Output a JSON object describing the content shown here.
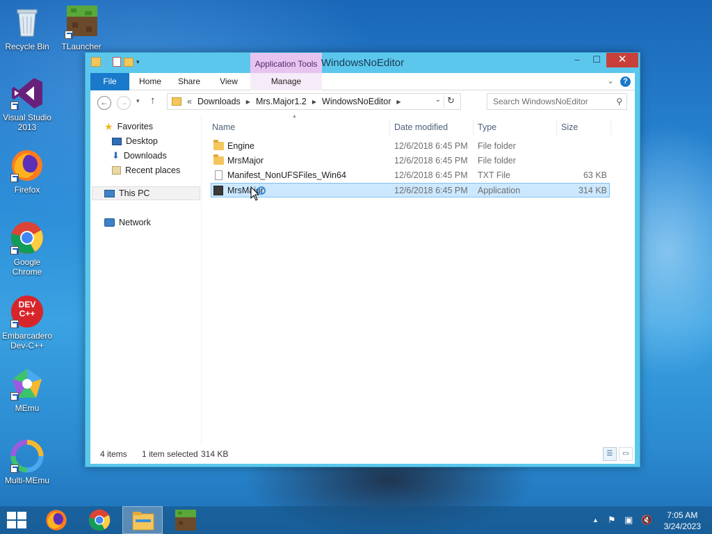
{
  "desktop": {
    "icons": [
      {
        "label": "Recycle Bin"
      },
      {
        "label": "TLauncher"
      },
      {
        "label": "Visual Studio 2013"
      },
      {
        "label": "Firefox"
      },
      {
        "label": "Google Chrome"
      },
      {
        "label": "Embarcadero Dev-C++"
      },
      {
        "label": "MEmu"
      },
      {
        "label": "Multi-MEmu"
      }
    ],
    "dev_logo_text": "DEV C++"
  },
  "window": {
    "title": "WindowsNoEditor",
    "context_tab": "Application Tools",
    "buttons": {
      "minimize": "–",
      "maximize": "☐",
      "close": "✕"
    }
  },
  "ribbon": {
    "tabs": [
      "File",
      "Home",
      "Share",
      "View",
      "Manage"
    ],
    "help": "?"
  },
  "address_bar": {
    "prefix": "«",
    "crumbs": [
      "Downloads",
      "Mrs.Major1.2",
      "WindowsNoEditor"
    ]
  },
  "search": {
    "placeholder": "Search WindowsNoEditor"
  },
  "nav_pane": {
    "favorites": "Favorites",
    "items": [
      "Desktop",
      "Downloads",
      "Recent places"
    ],
    "this_pc": "This PC",
    "network": "Network"
  },
  "file_list": {
    "columns": [
      "Name",
      "Date modified",
      "Type",
      "Size"
    ],
    "rows": [
      {
        "name": "Engine",
        "date": "12/6/2018 6:45 PM",
        "type": "File folder",
        "size": "",
        "icon": "folder-icon"
      },
      {
        "name": "MrsMajor",
        "date": "12/6/2018 6:45 PM",
        "type": "File folder",
        "size": "",
        "icon": "folder-icon"
      },
      {
        "name": "Manifest_NonUFSFiles_Win64",
        "date": "12/6/2018 6:45 PM",
        "type": "TXT File",
        "size": "63 KB",
        "icon": "text-file-icon"
      },
      {
        "name": "MrsMajor",
        "date": "12/6/2018 6:45 PM",
        "type": "Application",
        "size": "314 KB",
        "icon": "application-icon",
        "selected": true
      }
    ]
  },
  "status": {
    "items": "4 items",
    "selected": "1 item selected",
    "size": "314 KB"
  },
  "taskbar": {
    "clock_time": "7:05 AM",
    "clock_date": "3/24/2023"
  }
}
